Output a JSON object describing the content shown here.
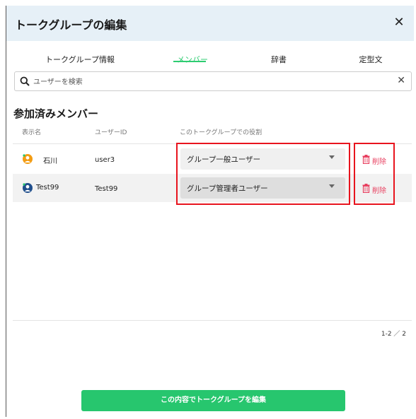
{
  "dialog": {
    "title": "トークグループの編集",
    "close_icon": "close-icon"
  },
  "tabs": [
    {
      "label": "トークグループ情報",
      "active": false
    },
    {
      "label": "メンバー",
      "active": true
    },
    {
      "label": "辞書",
      "active": false
    },
    {
      "label": "定型文",
      "active": false
    }
  ],
  "search": {
    "placeholder": "ユーザーを検索",
    "value": ""
  },
  "section_title": "参加済みメンバー",
  "table": {
    "headers": [
      "表示名",
      "ユーザーID",
      "このトークグループでの役割"
    ],
    "rows": [
      {
        "name": "石川",
        "user_id": "user3",
        "role": "グループ一般ユーザー",
        "avatar_color": "#f39c12",
        "delete_label": "削除"
      },
      {
        "name": "Test99",
        "user_id": "Test99",
        "role": "グループ管理者ユーザー",
        "avatar_color": "#1f4e8c",
        "delete_label": "削除"
      }
    ]
  },
  "pagination": "1-2 ／ 2",
  "submit_label": "この内容でトークグループを編集",
  "colors": {
    "accent": "#2ecc71",
    "header_bg": "#e6f0f7",
    "delete": "#e84060",
    "highlight_box": "#e8141e"
  }
}
